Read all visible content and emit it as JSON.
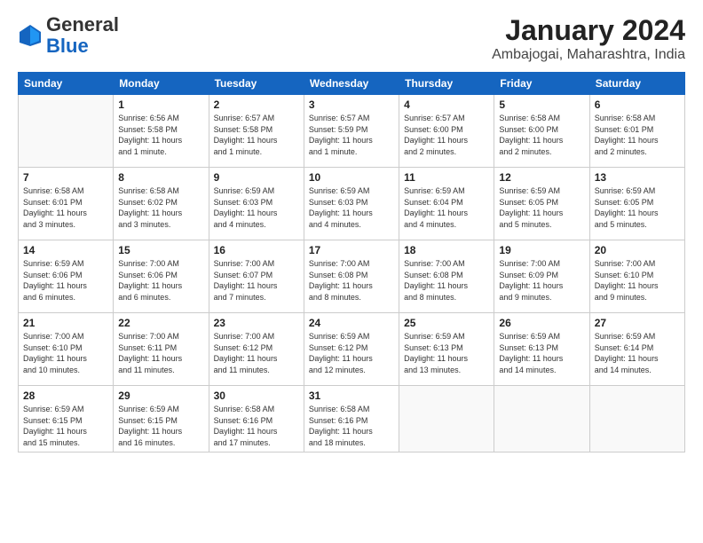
{
  "logo": {
    "general": "General",
    "blue": "Blue"
  },
  "title": {
    "month_year": "January 2024",
    "location": "Ambajogai, Maharashtra, India"
  },
  "days_of_week": [
    "Sunday",
    "Monday",
    "Tuesday",
    "Wednesday",
    "Thursday",
    "Friday",
    "Saturday"
  ],
  "weeks": [
    [
      {
        "day": "",
        "info": ""
      },
      {
        "day": "1",
        "info": "Sunrise: 6:56 AM\nSunset: 5:58 PM\nDaylight: 11 hours\nand 1 minute."
      },
      {
        "day": "2",
        "info": "Sunrise: 6:57 AM\nSunset: 5:58 PM\nDaylight: 11 hours\nand 1 minute."
      },
      {
        "day": "3",
        "info": "Sunrise: 6:57 AM\nSunset: 5:59 PM\nDaylight: 11 hours\nand 1 minute."
      },
      {
        "day": "4",
        "info": "Sunrise: 6:57 AM\nSunset: 6:00 PM\nDaylight: 11 hours\nand 2 minutes."
      },
      {
        "day": "5",
        "info": "Sunrise: 6:58 AM\nSunset: 6:00 PM\nDaylight: 11 hours\nand 2 minutes."
      },
      {
        "day": "6",
        "info": "Sunrise: 6:58 AM\nSunset: 6:01 PM\nDaylight: 11 hours\nand 2 minutes."
      }
    ],
    [
      {
        "day": "7",
        "info": "Sunrise: 6:58 AM\nSunset: 6:01 PM\nDaylight: 11 hours\nand 3 minutes."
      },
      {
        "day": "8",
        "info": "Sunrise: 6:58 AM\nSunset: 6:02 PM\nDaylight: 11 hours\nand 3 minutes."
      },
      {
        "day": "9",
        "info": "Sunrise: 6:59 AM\nSunset: 6:03 PM\nDaylight: 11 hours\nand 4 minutes."
      },
      {
        "day": "10",
        "info": "Sunrise: 6:59 AM\nSunset: 6:03 PM\nDaylight: 11 hours\nand 4 minutes."
      },
      {
        "day": "11",
        "info": "Sunrise: 6:59 AM\nSunset: 6:04 PM\nDaylight: 11 hours\nand 4 minutes."
      },
      {
        "day": "12",
        "info": "Sunrise: 6:59 AM\nSunset: 6:05 PM\nDaylight: 11 hours\nand 5 minutes."
      },
      {
        "day": "13",
        "info": "Sunrise: 6:59 AM\nSunset: 6:05 PM\nDaylight: 11 hours\nand 5 minutes."
      }
    ],
    [
      {
        "day": "14",
        "info": "Sunrise: 6:59 AM\nSunset: 6:06 PM\nDaylight: 11 hours\nand 6 minutes."
      },
      {
        "day": "15",
        "info": "Sunrise: 7:00 AM\nSunset: 6:06 PM\nDaylight: 11 hours\nand 6 minutes."
      },
      {
        "day": "16",
        "info": "Sunrise: 7:00 AM\nSunset: 6:07 PM\nDaylight: 11 hours\nand 7 minutes."
      },
      {
        "day": "17",
        "info": "Sunrise: 7:00 AM\nSunset: 6:08 PM\nDaylight: 11 hours\nand 8 minutes."
      },
      {
        "day": "18",
        "info": "Sunrise: 7:00 AM\nSunset: 6:08 PM\nDaylight: 11 hours\nand 8 minutes."
      },
      {
        "day": "19",
        "info": "Sunrise: 7:00 AM\nSunset: 6:09 PM\nDaylight: 11 hours\nand 9 minutes."
      },
      {
        "day": "20",
        "info": "Sunrise: 7:00 AM\nSunset: 6:10 PM\nDaylight: 11 hours\nand 9 minutes."
      }
    ],
    [
      {
        "day": "21",
        "info": "Sunrise: 7:00 AM\nSunset: 6:10 PM\nDaylight: 11 hours\nand 10 minutes."
      },
      {
        "day": "22",
        "info": "Sunrise: 7:00 AM\nSunset: 6:11 PM\nDaylight: 11 hours\nand 11 minutes."
      },
      {
        "day": "23",
        "info": "Sunrise: 7:00 AM\nSunset: 6:12 PM\nDaylight: 11 hours\nand 11 minutes."
      },
      {
        "day": "24",
        "info": "Sunrise: 6:59 AM\nSunset: 6:12 PM\nDaylight: 11 hours\nand 12 minutes."
      },
      {
        "day": "25",
        "info": "Sunrise: 6:59 AM\nSunset: 6:13 PM\nDaylight: 11 hours\nand 13 minutes."
      },
      {
        "day": "26",
        "info": "Sunrise: 6:59 AM\nSunset: 6:13 PM\nDaylight: 11 hours\nand 14 minutes."
      },
      {
        "day": "27",
        "info": "Sunrise: 6:59 AM\nSunset: 6:14 PM\nDaylight: 11 hours\nand 14 minutes."
      }
    ],
    [
      {
        "day": "28",
        "info": "Sunrise: 6:59 AM\nSunset: 6:15 PM\nDaylight: 11 hours\nand 15 minutes."
      },
      {
        "day": "29",
        "info": "Sunrise: 6:59 AM\nSunset: 6:15 PM\nDaylight: 11 hours\nand 16 minutes."
      },
      {
        "day": "30",
        "info": "Sunrise: 6:58 AM\nSunset: 6:16 PM\nDaylight: 11 hours\nand 17 minutes."
      },
      {
        "day": "31",
        "info": "Sunrise: 6:58 AM\nSunset: 6:16 PM\nDaylight: 11 hours\nand 18 minutes."
      },
      {
        "day": "",
        "info": ""
      },
      {
        "day": "",
        "info": ""
      },
      {
        "day": "",
        "info": ""
      }
    ]
  ]
}
